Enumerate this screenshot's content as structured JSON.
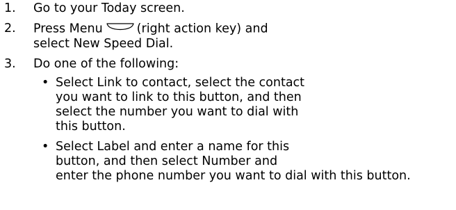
{
  "steps": [
    {
      "number": "1.",
      "lines": [
        "Go to your Today screen."
      ]
    },
    {
      "number": "2.",
      "line1_before_icon": "Press Menu",
      "line1_icon": "right-action-key-icon",
      "line1_after_icon": "(right action key) and",
      "line2": "select New Speed Dial."
    },
    {
      "number": "3.",
      "lines": [
        "Do one of the following:"
      ],
      "bullets": [
        {
          "glyph": "•",
          "lines": [
            "Select Link to contact, select the contact",
            "you want to link to this button, and then",
            "select the number you want to dial with",
            "this button."
          ]
        },
        {
          "glyph": "•",
          "lines": [
            "Select Label and enter a name for this",
            "button, and then select Number and",
            "enter the phone number you want to dial with this button."
          ]
        }
      ]
    }
  ]
}
